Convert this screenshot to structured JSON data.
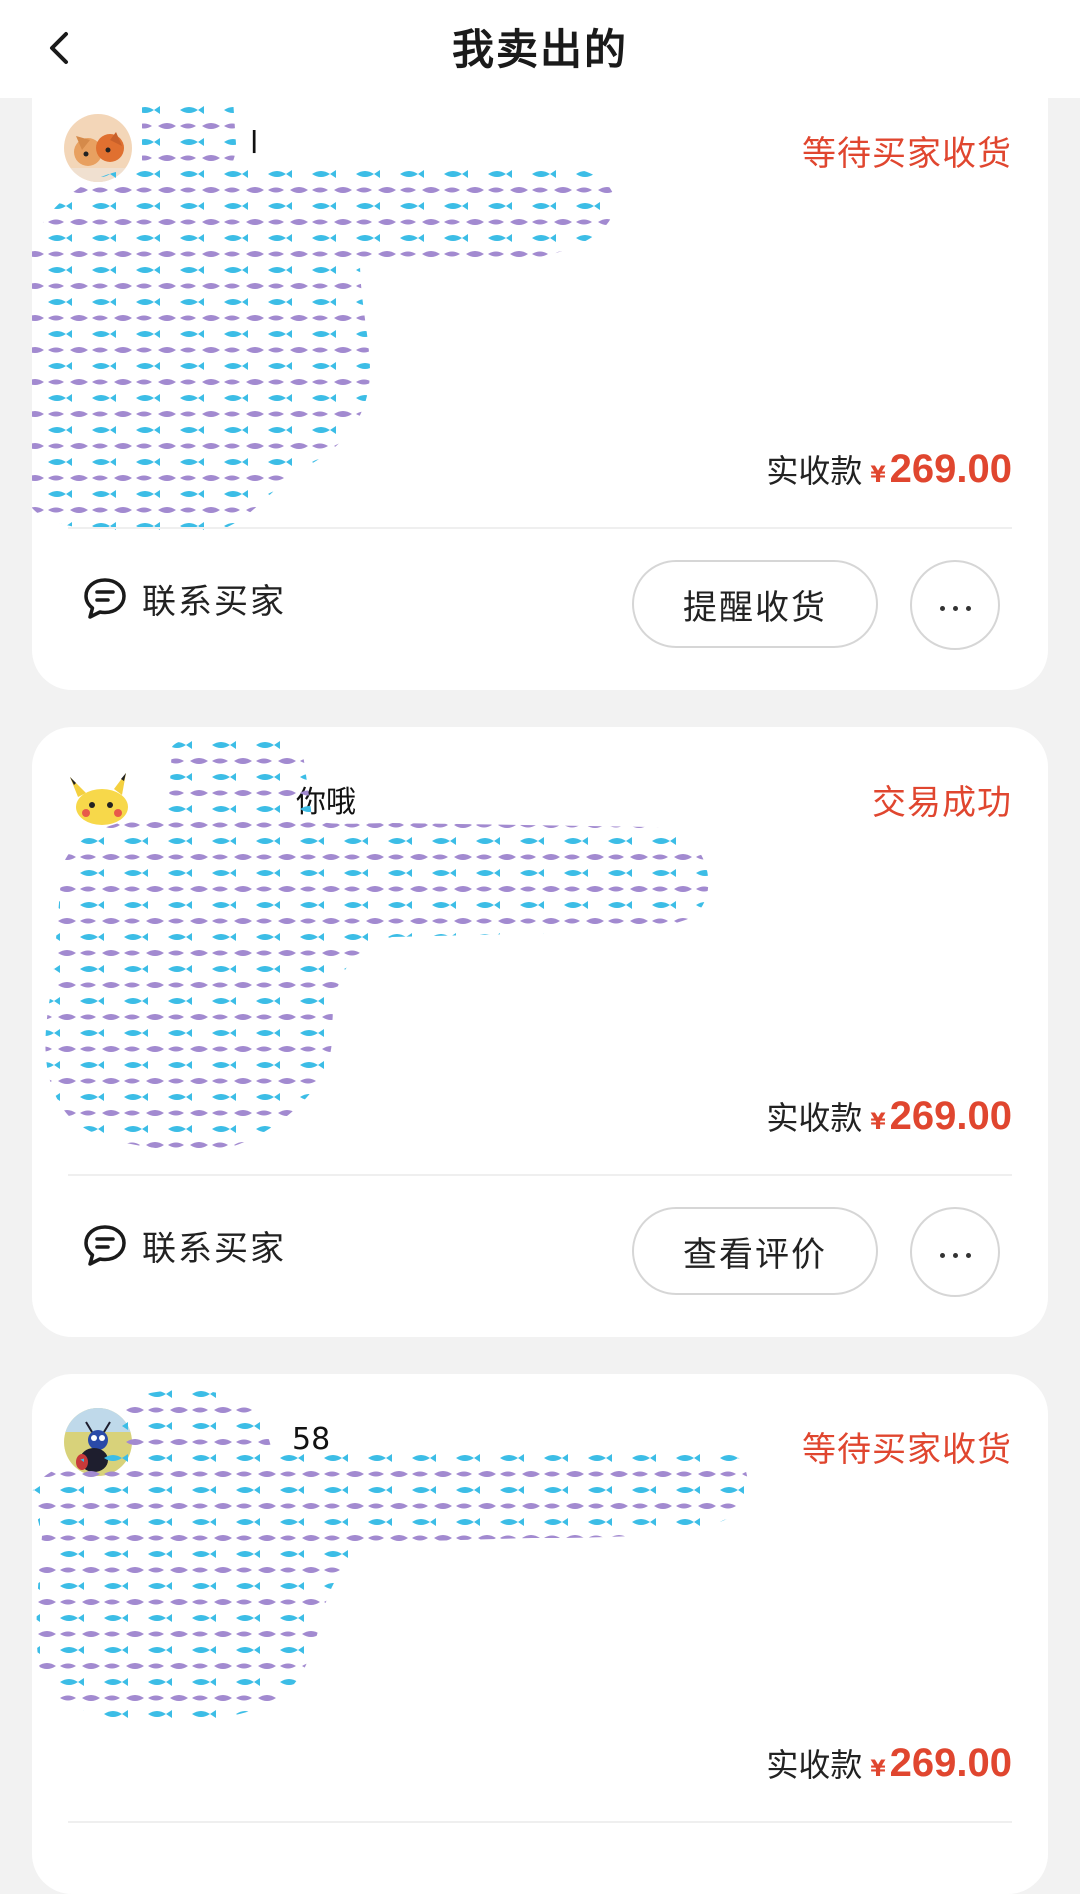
{
  "header": {
    "title": "我卖出的",
    "back_icon": "chevron-left-icon"
  },
  "orders": [
    {
      "buyer_name": "l",
      "status": "等待买家收货",
      "price_label": "实收款",
      "currency": "¥",
      "price": "269.00",
      "contact_label": "联系买家",
      "action_label": "提醒收货"
    },
    {
      "buyer_name": "你哦",
      "status": "交易成功",
      "price_label": "实收款",
      "currency": "¥",
      "price": "269.00",
      "contact_label": "联系买家",
      "action_label": "查看评价"
    },
    {
      "buyer_name": "58",
      "status": "等待买家收货",
      "price_label": "实收款",
      "currency": "¥",
      "price": "269.00"
    }
  ],
  "colors": {
    "status_red": "#e0462f",
    "mask_blue": "#3cbde6",
    "mask_purple": "#a28ad0"
  }
}
